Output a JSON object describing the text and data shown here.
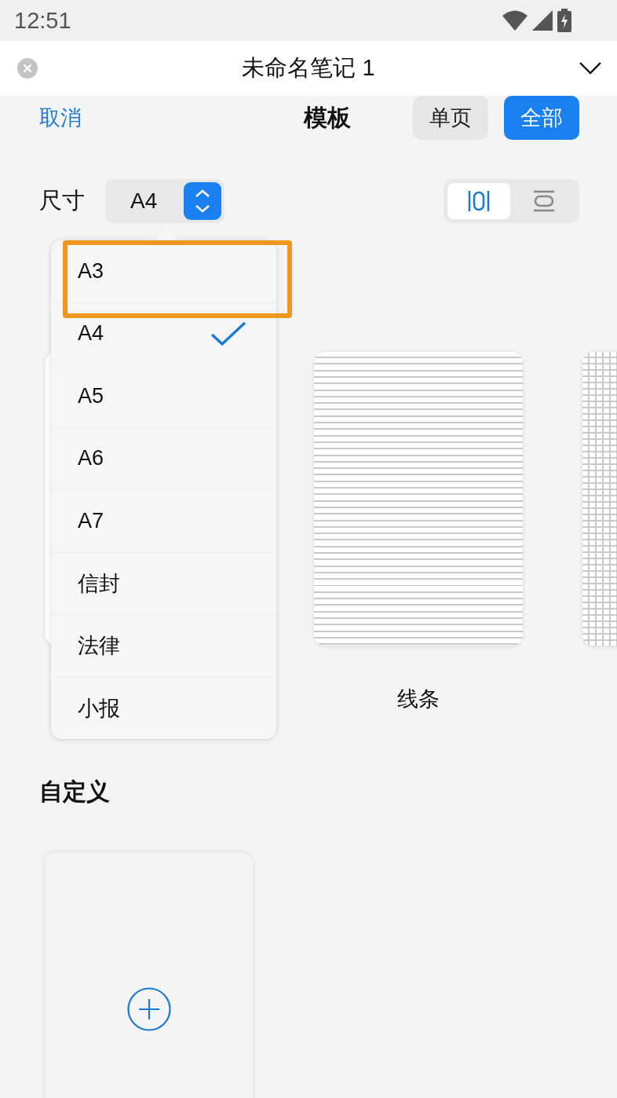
{
  "status_bar": {
    "time": "12:51"
  },
  "title_bar": {
    "title": "未命名笔记 1"
  },
  "sheet_header": {
    "cancel": "取消",
    "title": "模板",
    "segments": [
      {
        "label": "单页",
        "selected": false
      },
      {
        "label": "全部",
        "selected": true
      }
    ]
  },
  "size": {
    "label": "尺寸",
    "value": "A4"
  },
  "orientation": [
    {
      "kind": "portrait",
      "selected": true
    },
    {
      "kind": "landscape",
      "selected": false
    }
  ],
  "size_menu": {
    "items": [
      {
        "label": "A3",
        "selected": false,
        "highlighted": true
      },
      {
        "label": "A4",
        "selected": true,
        "highlighted": false
      },
      {
        "label": "A5",
        "selected": false,
        "highlighted": false
      },
      {
        "label": "A6",
        "selected": false,
        "highlighted": false
      },
      {
        "label": "A7",
        "selected": false,
        "highlighted": false
      },
      {
        "label": "信封",
        "selected": false,
        "highlighted": false
      },
      {
        "label": "法律",
        "selected": false,
        "highlighted": false
      },
      {
        "label": "小报",
        "selected": false,
        "highlighted": false
      }
    ]
  },
  "templates": [
    {
      "kind": "blank"
    },
    {
      "kind": "lined",
      "label": "线条"
    },
    {
      "kind": "grid"
    }
  ],
  "custom": {
    "title": "自定义"
  }
}
